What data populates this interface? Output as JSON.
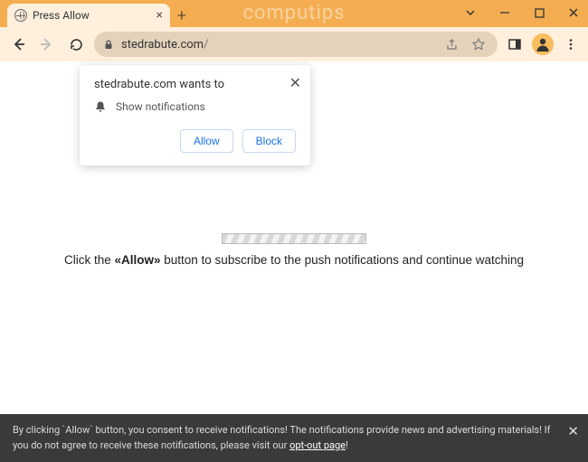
{
  "browser": {
    "tab_title": "Press Allow",
    "url_host": "stedrabute.com",
    "url_path": "/",
    "watermark": "computips"
  },
  "popup": {
    "title": "stedrabute.com wants to",
    "permission_label": "Show notifications",
    "allow_label": "Allow",
    "block_label": "Block"
  },
  "page": {
    "instruction_prefix": "Click the ",
    "instruction_bold": "«Allow»",
    "instruction_suffix": " button to subscribe to the push notifications and continue watching"
  },
  "consent": {
    "text_part1": "By clicking `Allow` button, you consent to receive notifications! The notifications provide news and advertising materials! If you do not agree to receive these notifications, please visit our ",
    "link_text": "opt-out page",
    "text_part2": "!"
  }
}
